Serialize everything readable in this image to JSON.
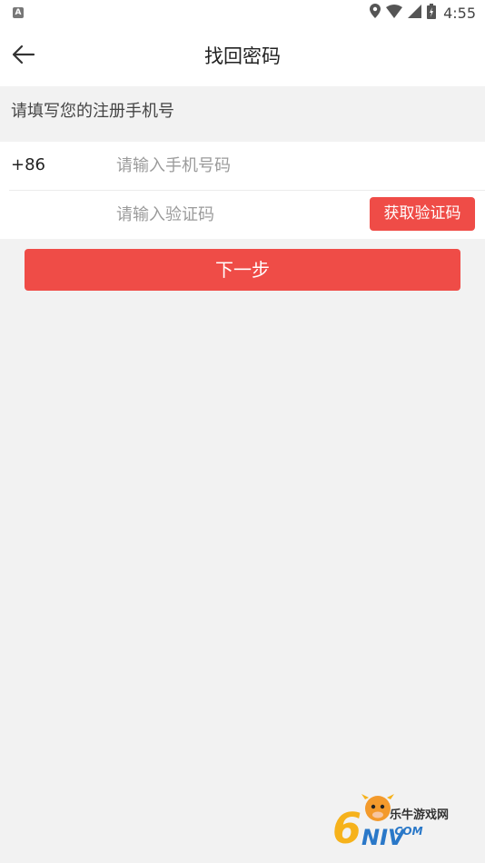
{
  "status_bar": {
    "app_icon_letter": "A",
    "time": "4:55"
  },
  "header": {
    "title": "找回密码"
  },
  "form": {
    "hint": "请填写您的注册手机号",
    "country_code": "+86",
    "phone_placeholder": "请输入手机号码",
    "phone_value": "",
    "code_placeholder": "请输入验证码",
    "code_value": "",
    "get_code_label": "获取验证码"
  },
  "actions": {
    "next_label": "下一步"
  },
  "watermark": {
    "name": "乐牛游戏网",
    "domain": ".COM"
  },
  "colors": {
    "accent": "#ef4c47",
    "background": "#f2f2f2",
    "surface": "#ffffff"
  }
}
